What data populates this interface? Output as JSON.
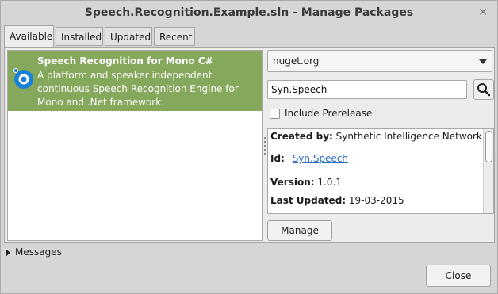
{
  "window": {
    "title": "Speech.Recognition.Example.sln - Manage Packages",
    "close_glyph": "✕"
  },
  "tabs": [
    {
      "label": "Available"
    },
    {
      "label": "Installed"
    },
    {
      "label": "Updated"
    },
    {
      "label": "Recent"
    }
  ],
  "package_list": {
    "items": [
      {
        "title": "Speech Recognition for Mono C#",
        "description": "A platform and speaker independent continuous Speech Recognition Engine for Mono and .Net framework.",
        "icon": "speech-package-icon"
      }
    ]
  },
  "source": {
    "selected": "nuget.org"
  },
  "search": {
    "value": "Syn.Speech",
    "icon": "search-icon"
  },
  "prerelease": {
    "label": "Include Prerelease",
    "checked": false
  },
  "details": {
    "created_by": {
      "label": "Created by:",
      "value": "Synthetic Intelligence Network"
    },
    "id": {
      "label": "Id:",
      "value": "Syn.Speech"
    },
    "version": {
      "label": "Version:",
      "value": "1.0.1"
    },
    "last_updated": {
      "label": "Last Updated:",
      "value": "19-03-2015"
    }
  },
  "buttons": {
    "manage": "Manage",
    "close": "Close"
  },
  "messages": {
    "label": "Messages"
  },
  "colors": {
    "selected_row": "#86a85d",
    "link": "#2a6fc2",
    "icon_blue": "#1a82d6"
  }
}
